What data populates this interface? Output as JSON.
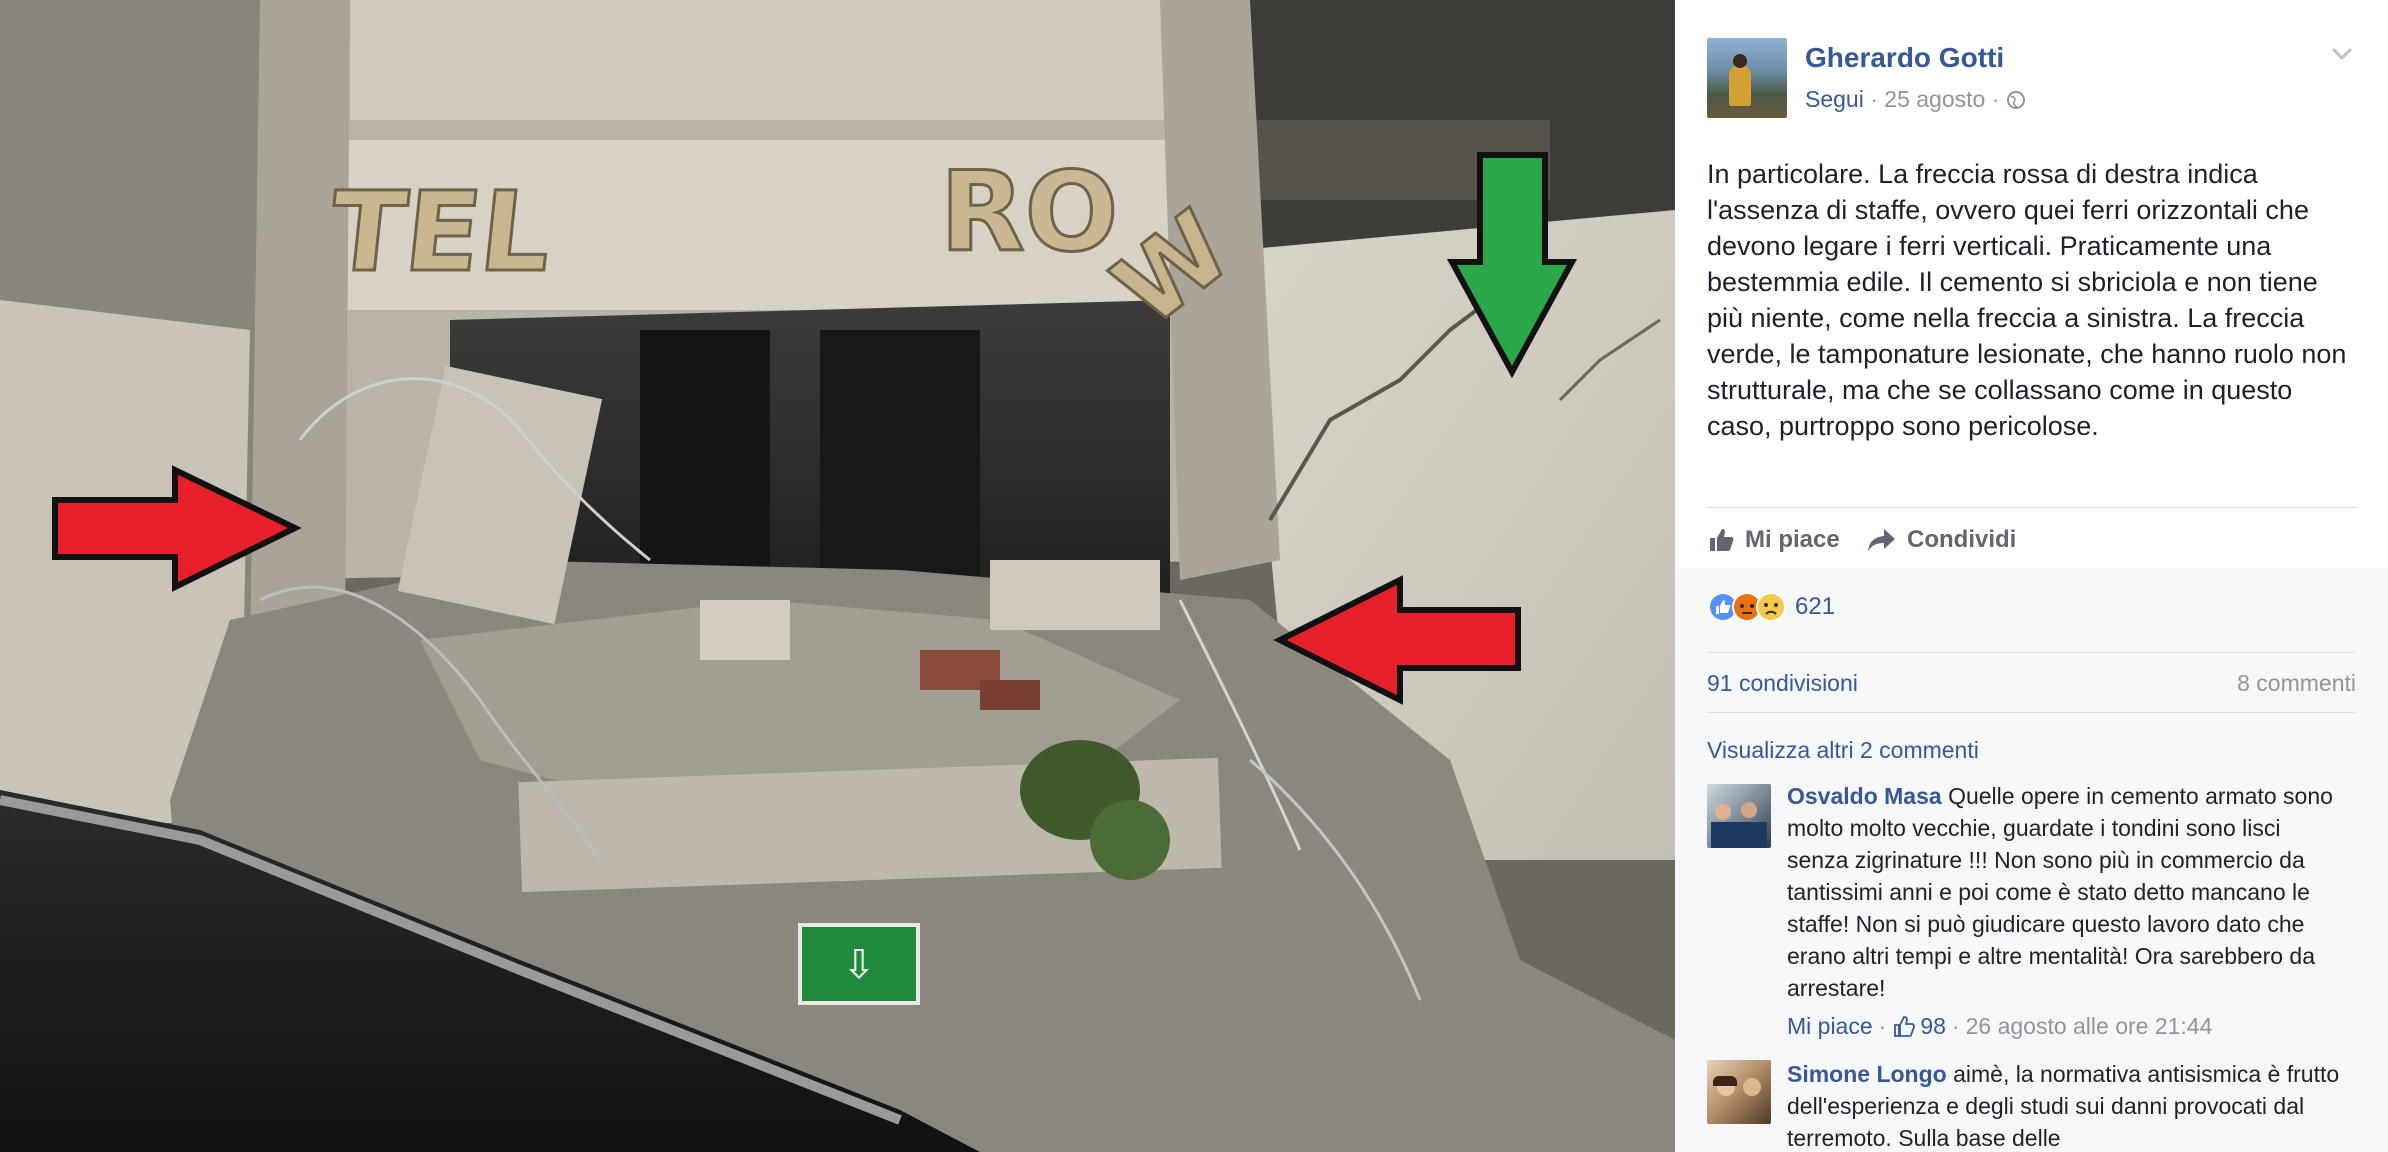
{
  "photo": {
    "sign_letters_left": "TEL",
    "sign_letters_right": "RO",
    "sign_letter_fallen": "W"
  },
  "post": {
    "author": "Gherardo Gotti",
    "follow_label": "Segui",
    "date": "25 agosto",
    "separator": "·",
    "text": "In particolare. La freccia rossa di destra indica l'assenza di staffe, ovvero quei ferri orizzontali che devono legare i ferri verticali. Praticamente una bestemmia edile. Il cemento si sbriciola e non tiene più niente, come nella freccia a sinistra. La freccia verde, le tamponature lesionate, che hanno ruolo non strutturale, ma che se collassano come in questo caso, purtroppo sono pericolose.",
    "like_label": "Mi piace",
    "share_label": "Condividi",
    "reactions_count": "621",
    "shares_label": "91 condivisioni",
    "comments_label": "8 commenti",
    "view_more_label": "Visualizza altri 2 commenti"
  },
  "comments": [
    {
      "name": "Osvaldo Masa",
      "text": "Quelle opere in cemento armato sono molto molto vecchie, guardate i tondini sono lisci senza zigrinature !!! Non sono più in commercio da tantissimi anni e poi come è stato detto mancano le staffe! Non si può giudicare questo lavoro dato che erano altri tempi e altre mentalità! Ora sarebbero da arrestare!",
      "like_label": "Mi piace",
      "like_count": "98",
      "timestamp": "26 agosto alle ore 21:44"
    },
    {
      "name": "Simone Longo",
      "text": "aimè, la normativa antisismica è frutto dell'esperienza e degli studi sui danni provocati dal terremoto. Sulla base delle"
    }
  ],
  "colors": {
    "link": "#365899",
    "text": "#1d2129",
    "meta": "#90949c",
    "red_arrow": "#e8202a",
    "green_arrow": "#2aa84a"
  }
}
